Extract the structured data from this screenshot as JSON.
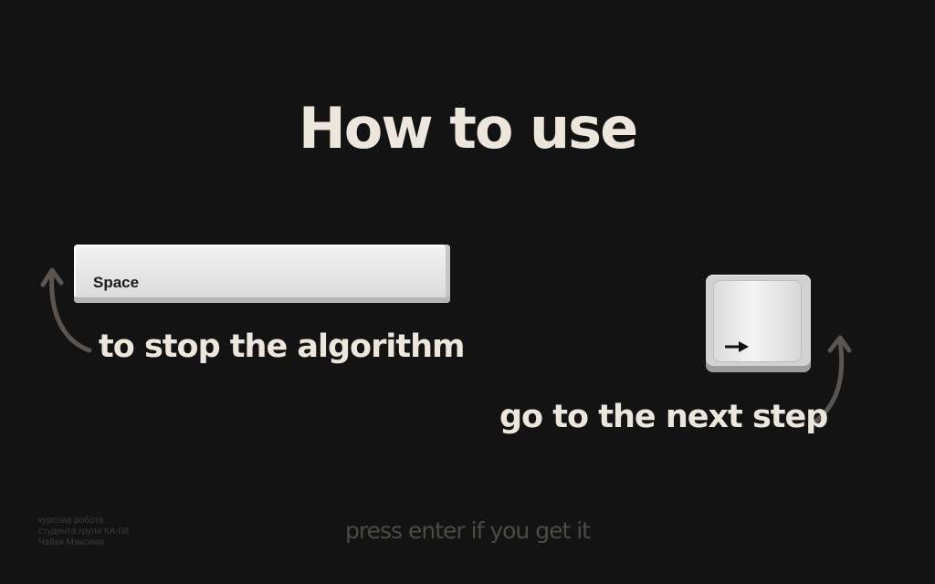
{
  "title": "How to use",
  "keys": {
    "space_label": "Space",
    "arrow_icon": "right-arrow-icon"
  },
  "captions": {
    "stop": "to stop the algorithm",
    "next": "go to the next step"
  },
  "footer": {
    "credits": [
      "курсова робота",
      "студента групи КА-08",
      "Чайки Максима"
    ],
    "hint": "press enter if you get it"
  },
  "colors": {
    "background": "#131313",
    "text": "#ece6dc",
    "hint": "#4d4a46",
    "credits": "#3a3a3a",
    "curve": "#5a5550"
  }
}
